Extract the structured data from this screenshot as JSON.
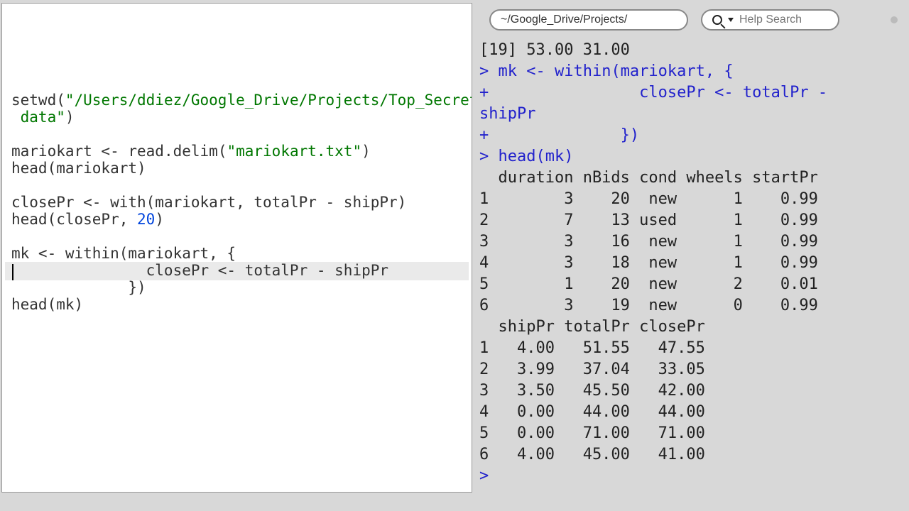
{
  "toolbar": {
    "path": "~/Google_Drive/Projects/",
    "search_placeholder": "Help Search"
  },
  "editor": {
    "lines": [
      {
        "type": "code",
        "segs": [
          {
            "t": "setwd",
            "c": "fn"
          },
          {
            "t": "(",
            "c": ""
          },
          {
            "t": "\"/Users/ddiez/Google_Drive/Projects/Top_Secret/",
            "c": "str"
          }
        ]
      },
      {
        "type": "code",
        "segs": [
          {
            "t": " data\"",
            "c": "str"
          },
          {
            "t": ")",
            "c": ""
          }
        ]
      },
      {
        "type": "blank"
      },
      {
        "type": "code",
        "segs": [
          {
            "t": "mariokart <- ",
            "c": ""
          },
          {
            "t": "read.delim",
            "c": "fn"
          },
          {
            "t": "(",
            "c": ""
          },
          {
            "t": "\"mariokart.txt\"",
            "c": "str"
          },
          {
            "t": ")",
            "c": ""
          }
        ]
      },
      {
        "type": "code",
        "segs": [
          {
            "t": "head",
            "c": "fn"
          },
          {
            "t": "(mariokart)",
            "c": ""
          }
        ]
      },
      {
        "type": "blank"
      },
      {
        "type": "code",
        "segs": [
          {
            "t": "closePr <- ",
            "c": ""
          },
          {
            "t": "with",
            "c": "fn"
          },
          {
            "t": "(mariokart, totalPr - shipPr)",
            "c": ""
          }
        ]
      },
      {
        "type": "code",
        "segs": [
          {
            "t": "head",
            "c": "fn"
          },
          {
            "t": "(closePr, ",
            "c": ""
          },
          {
            "t": "20",
            "c": "num"
          },
          {
            "t": ")",
            "c": ""
          }
        ]
      },
      {
        "type": "blank"
      },
      {
        "type": "code",
        "segs": [
          {
            "t": "mk <- ",
            "c": ""
          },
          {
            "t": "within",
            "c": "fn"
          },
          {
            "t": "(mariokart, {",
            "c": ""
          }
        ]
      },
      {
        "type": "code",
        "segs": [
          {
            "t": "               closePr <- totalPr - shipPr",
            "c": ""
          }
        ]
      },
      {
        "type": "code",
        "segs": [
          {
            "t": "             })",
            "c": ""
          }
        ]
      },
      {
        "type": "code",
        "segs": [
          {
            "t": "head",
            "c": "fn"
          },
          {
            "t": "(mk)",
            "c": ""
          }
        ]
      }
    ]
  },
  "console": {
    "prev_out": "[19] 53.00 31.00",
    "cmd_lines": [
      {
        "prompt": "> ",
        "text": "mk <- within(mariokart, {"
      },
      {
        "prompt": "+ ",
        "text": "               closePr <- totalPr - "
      },
      {
        "prompt": "",
        "text": "shipPr"
      },
      {
        "prompt": "+ ",
        "text": "             })"
      },
      {
        "prompt": "> ",
        "text": "head(mk)"
      }
    ],
    "table1_header": "  duration nBids cond wheels startPr",
    "table1_rows": [
      "1        3    20  new      1    0.99",
      "2        7    13 used      1    0.99",
      "3        3    16  new      1    0.99",
      "4        3    18  new      1    0.99",
      "5        1    20  new      2    0.01",
      "6        3    19  new      0    0.99"
    ],
    "table2_header": "  shipPr totalPr closePr",
    "table2_rows": [
      "1   4.00   51.55   47.55",
      "2   3.99   37.04   33.05",
      "3   3.50   45.50   42.00",
      "4   0.00   44.00   44.00",
      "5   0.00   71.00   71.00",
      "6   4.00   45.00   41.00"
    ],
    "final_prompt": "> "
  }
}
